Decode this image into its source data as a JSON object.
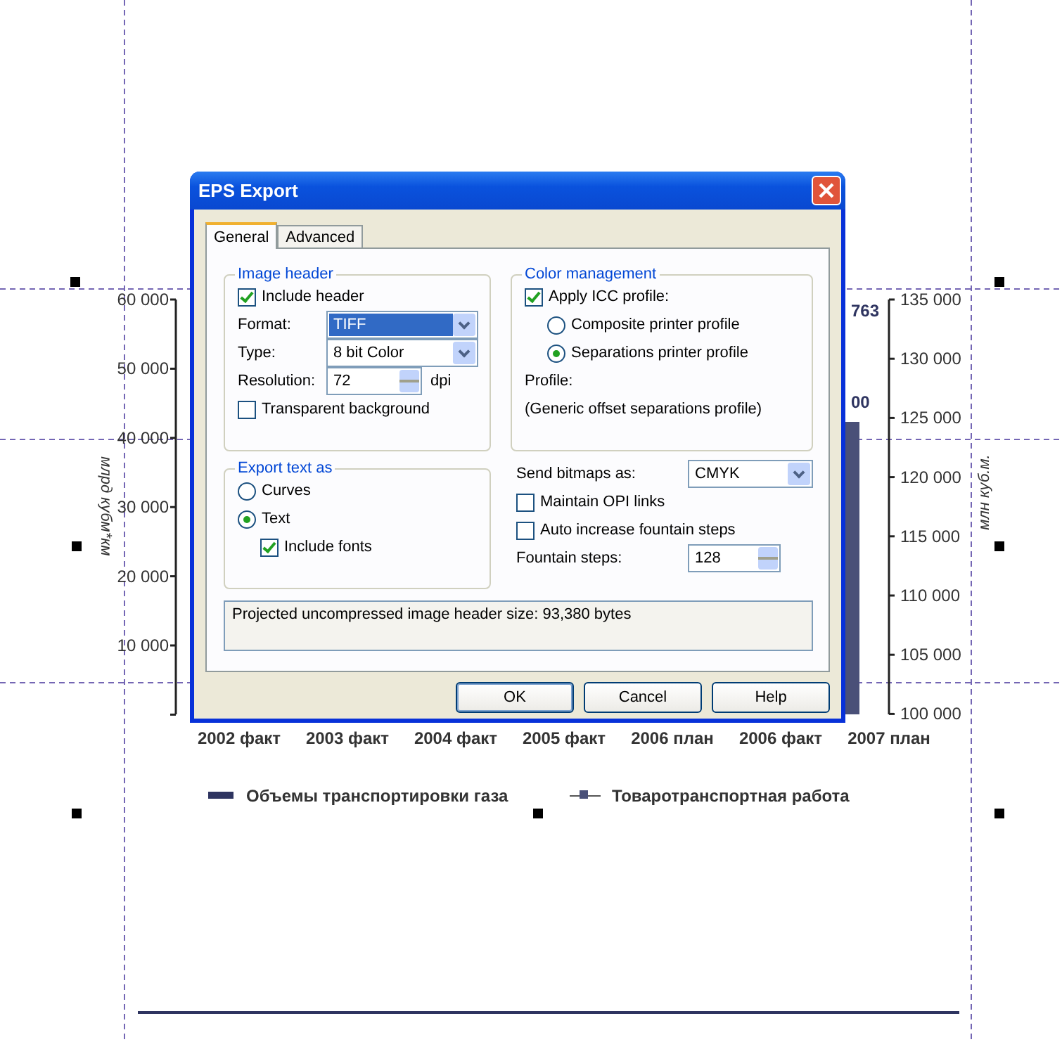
{
  "canvas": {
    "left_axis": {
      "title": "млрд кубм*км",
      "ticks": [
        "60 000",
        "50 000",
        "40 000",
        "30 000",
        "20 000",
        "10 000"
      ]
    },
    "right_axis": {
      "title": "млн куб.м.",
      "ticks": [
        "135 000",
        "130 000",
        "125 000",
        "120 000",
        "115 000",
        "110 000",
        "105 000",
        "100 000"
      ]
    },
    "categories": [
      "2002 факт",
      "2003 факт",
      "2004 факт",
      "2005 факт",
      "2006 план",
      "2006 факт",
      "2007 план"
    ],
    "value_labels": [
      "763",
      "00"
    ],
    "legend": [
      {
        "kind": "bar",
        "label": "Объемы транспортировки газа"
      },
      {
        "kind": "line",
        "label": "Товаротранспортная работа"
      }
    ]
  },
  "dialog": {
    "title": "EPS Export",
    "tabs": [
      {
        "label": "General",
        "selected": true
      },
      {
        "label": "Advanced",
        "selected": false
      }
    ],
    "image_header": {
      "title": "Image header",
      "include_header": {
        "label": "Include header",
        "checked": true
      },
      "format": {
        "label": "Format:",
        "value": "TIFF"
      },
      "type": {
        "label": "Type:",
        "value": "8 bit Color"
      },
      "resolution": {
        "label": "Resolution:",
        "value": "72",
        "unit": "dpi"
      },
      "transparent_background": {
        "label": "Transparent background",
        "checked": false
      }
    },
    "export_text_as": {
      "title": "Export text as",
      "options": [
        {
          "label": "Curves",
          "selected": false
        },
        {
          "label": "Text",
          "selected": true
        }
      ],
      "include_fonts": {
        "label": "Include fonts",
        "checked": true
      }
    },
    "color_management": {
      "title": "Color management",
      "apply_icc": {
        "label": "Apply ICC profile:",
        "checked": true
      },
      "options": [
        {
          "label": "Composite printer profile",
          "selected": false
        },
        {
          "label": "Separations printer profile",
          "selected": true
        }
      ],
      "profile_label": "Profile:",
      "profile_value": "(Generic offset separations profile)"
    },
    "send_bitmaps_as": {
      "label": "Send bitmaps as:",
      "value": "CMYK"
    },
    "maintain_opi": {
      "label": "Maintain OPI links",
      "checked": false
    },
    "auto_increase": {
      "label": "Auto increase fountain steps",
      "checked": false
    },
    "fountain_steps": {
      "label": "Fountain steps:",
      "value": "128"
    },
    "info": "Projected uncompressed image header size: 93,380 bytes",
    "buttons": [
      "OK",
      "Cancel",
      "Help"
    ]
  }
}
